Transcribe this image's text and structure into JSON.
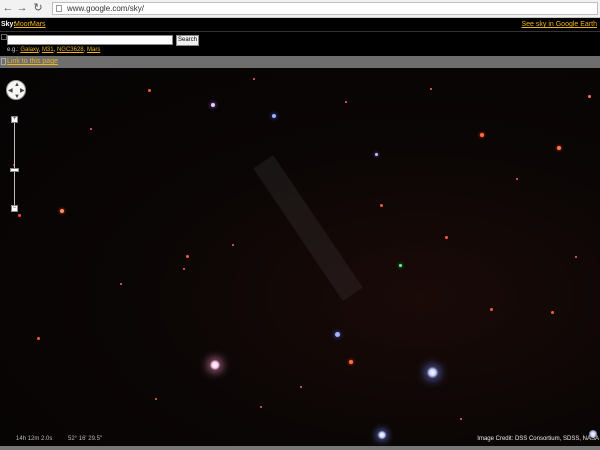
{
  "browser": {
    "url": "www.google.com/sky/"
  },
  "skybar": {
    "label": "Sky:",
    "links": [
      "Moon",
      "Mars"
    ],
    "earth_link": "See sky in Google Earth"
  },
  "search": {
    "value": "",
    "button_label": "Search",
    "examples_prefix": "e.g.:",
    "examples": [
      "Galaxy",
      "M31",
      "NGC3628",
      "Mars"
    ]
  },
  "link_bar": {
    "label": "Link to this page"
  },
  "status": {
    "ra": "14h 12m 2.0s",
    "dec": "52° 16' 29.5\"",
    "credit": "Image Credit: DSS Consortium, SDSS, NASA"
  },
  "colors": {
    "link": "#f0b419",
    "link_bar": "#6e6e6e"
  }
}
